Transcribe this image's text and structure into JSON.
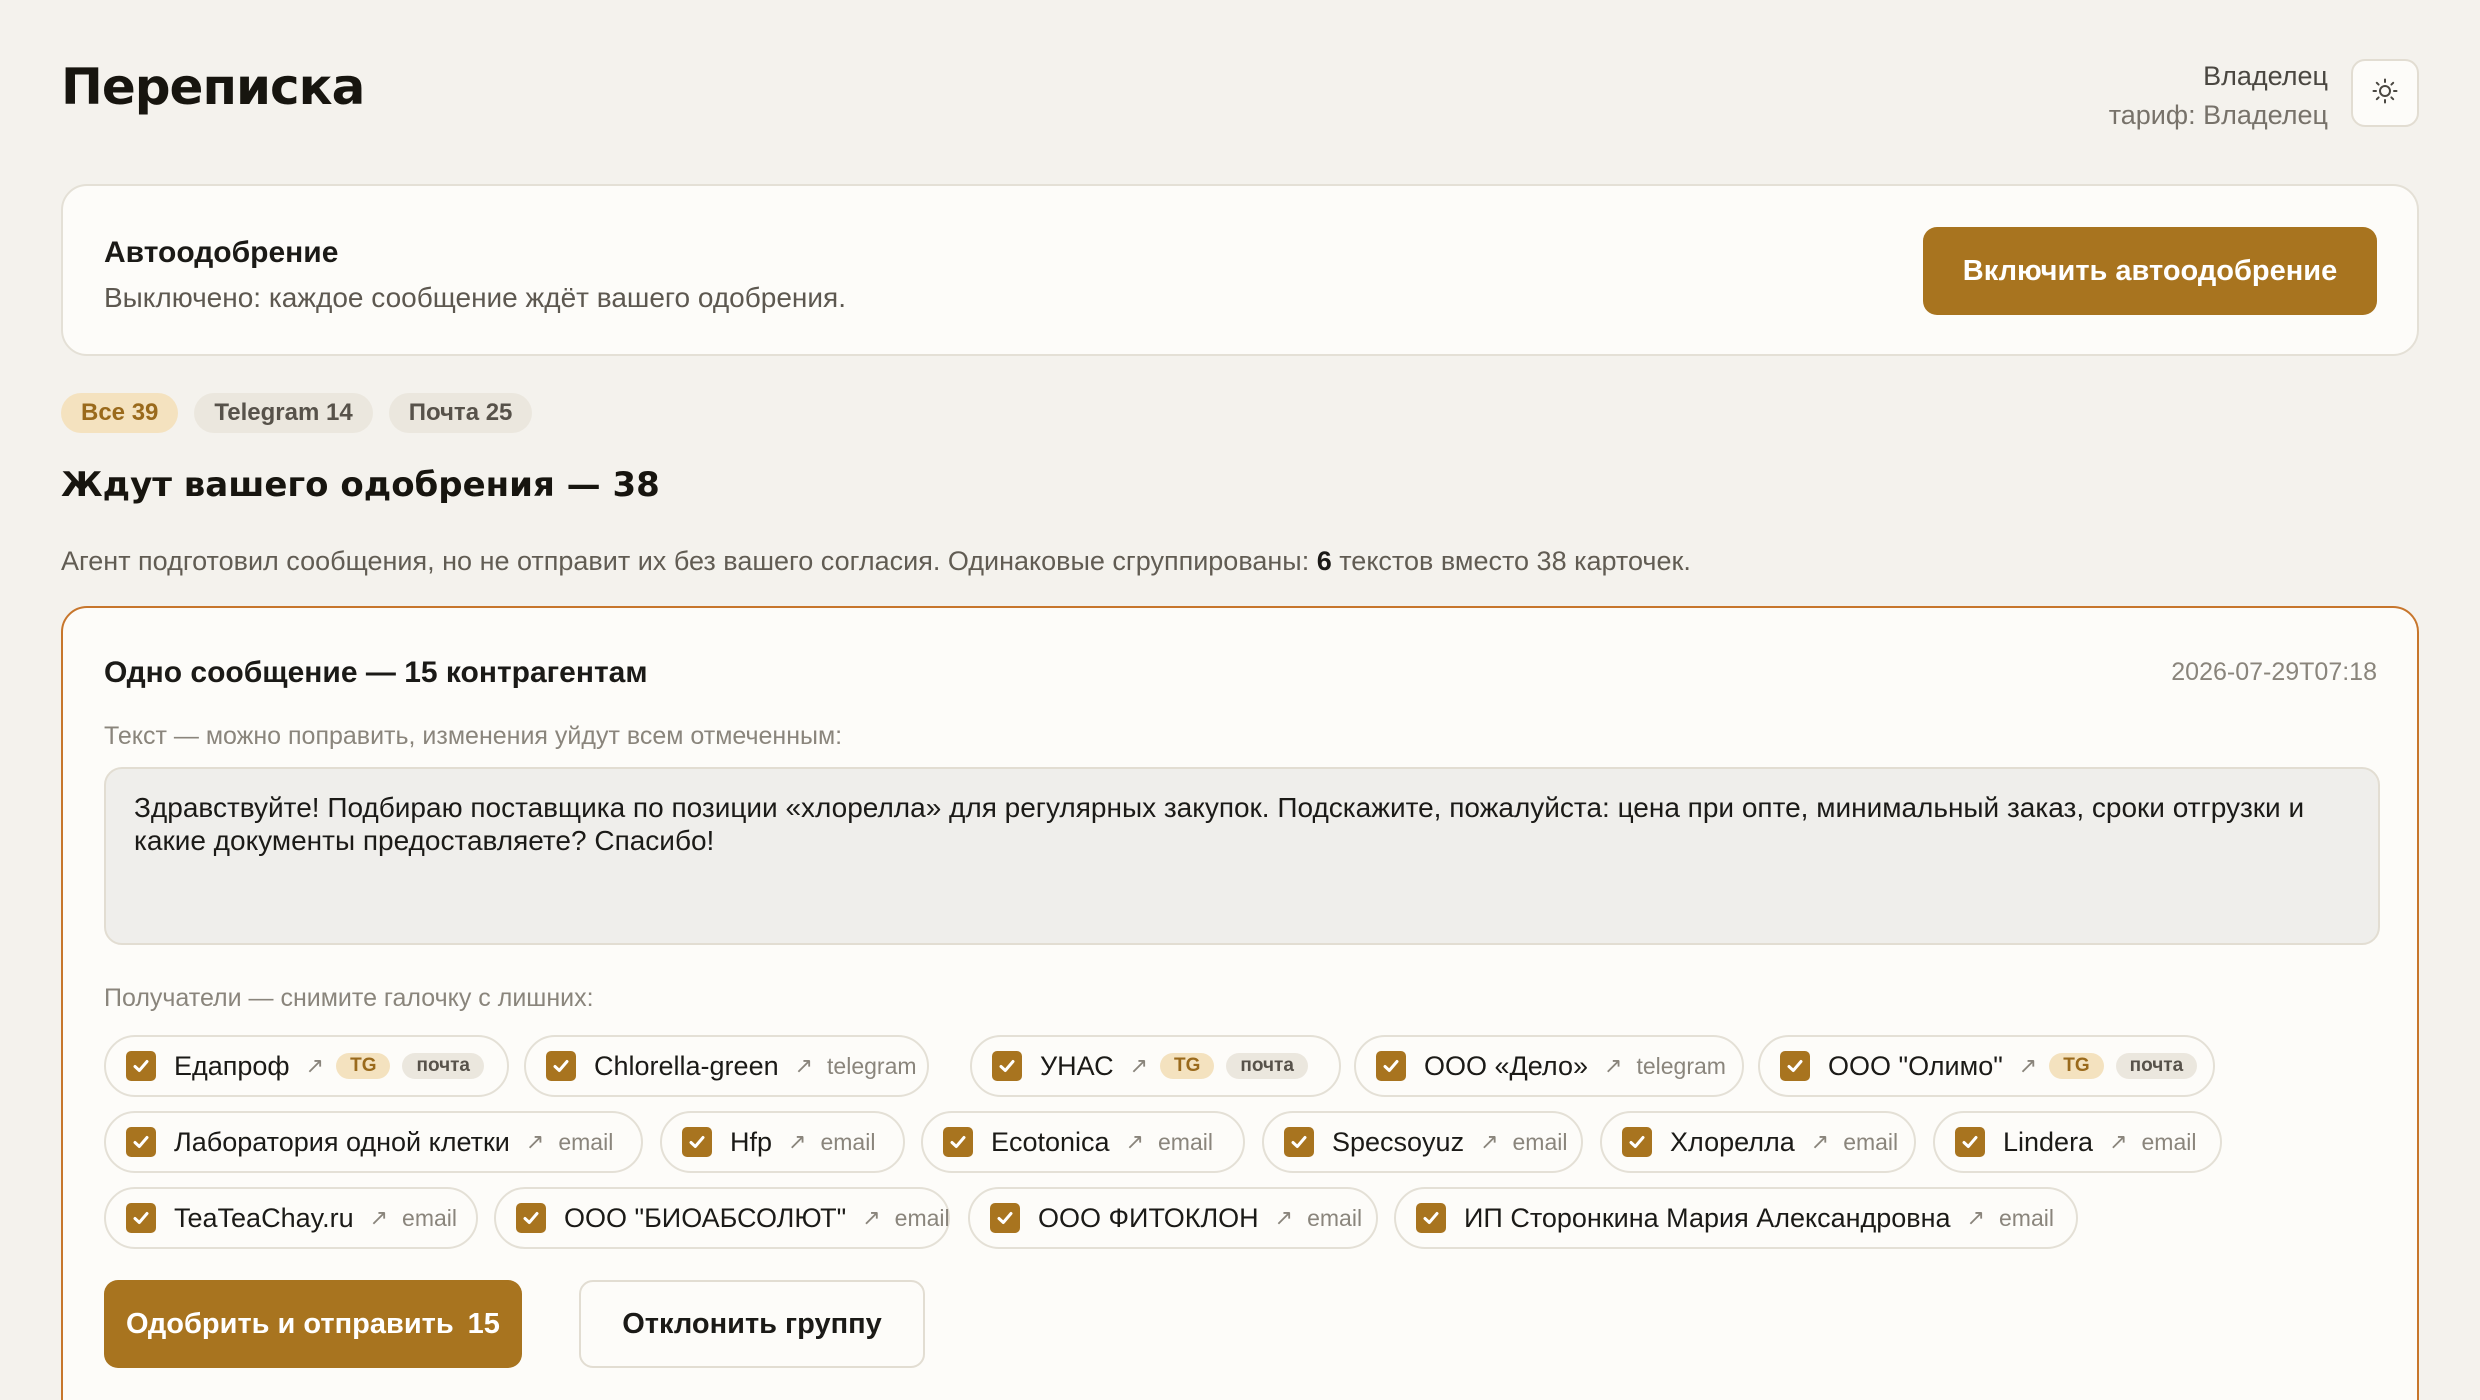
{
  "header": {
    "title": "Переписка",
    "user_name": "Владелец",
    "user_plan": "тариф: Владелец",
    "theme_icon": "sun-icon"
  },
  "auto_approve": {
    "title": "Автоодобрение",
    "description": "Выключено: каждое сообщение ждёт вашего одобрения.",
    "button_label": "Включить автоодобрение"
  },
  "filters": [
    {
      "label": "Все 39",
      "active": true
    },
    {
      "label": "Telegram 14",
      "active": false
    },
    {
      "label": "Почта 25",
      "active": false
    }
  ],
  "section": {
    "title": "Ждут вашего одобрения — 38",
    "subtitle_before": "Агент подготовил сообщения, но не отправит их без вашего согласия. Одинаковые сгруппированы: ",
    "subtitle_count": "6",
    "subtitle_after": " текстов вместо 38 карточек."
  },
  "group": {
    "title": "Одно сообщение — 15 контрагентам",
    "date": "2026-07-29T07:18",
    "text_label": "Текст — можно поправить, изменения уйдут всем отмеченным:",
    "message": "Здравствуйте! Подбираю поставщика по позиции «хлорелла» для регулярных закупок. Подскажите, пожалуйста: цена при опте, минимальный заказ, сроки отгрузки и какие документы предоставляете? Спасибо!",
    "recipients_label": "Получатели — снимите галочку с лишних:",
    "link_glyph": "↗",
    "tag_tg": "TG",
    "tag_mail": "почта",
    "recipients": [
      {
        "name": "Едапроф",
        "checked": true,
        "channel": "",
        "tg": true,
        "mail": true
      },
      {
        "name": "Chlorella-green",
        "checked": true,
        "channel": "telegram",
        "tg": false,
        "mail": false
      },
      {
        "name": "УНАС",
        "checked": true,
        "channel": "",
        "tg": true,
        "mail": true
      },
      {
        "name": "ООО «Дело»",
        "checked": true,
        "channel": "telegram",
        "tg": false,
        "mail": false
      },
      {
        "name": "ООО \"Олимо\"",
        "checked": true,
        "channel": "",
        "tg": true,
        "mail": true
      },
      {
        "name": "Лаборатория одной клетки",
        "checked": true,
        "channel": "email",
        "tg": false,
        "mail": false
      },
      {
        "name": "Hfp",
        "checked": true,
        "channel": "email",
        "tg": false,
        "mail": false
      },
      {
        "name": "Ecotonica",
        "checked": true,
        "channel": "email",
        "tg": false,
        "mail": false
      },
      {
        "name": "Specsoyuz",
        "checked": true,
        "channel": "email",
        "tg": false,
        "mail": false
      },
      {
        "name": "Хлорелла",
        "checked": true,
        "channel": "email",
        "tg": false,
        "mail": false
      },
      {
        "name": "Lindera",
        "checked": true,
        "channel": "email",
        "tg": false,
        "mail": false
      },
      {
        "name": "TeaTeaChay.ru",
        "checked": true,
        "channel": "email",
        "tg": false,
        "mail": false
      },
      {
        "name": "ООО \"БИОАБСОЛЮТ\"",
        "checked": true,
        "channel": "email",
        "tg": false,
        "mail": false
      },
      {
        "name": "ООО ФИТОКЛОН",
        "checked": true,
        "channel": "email",
        "tg": false,
        "mail": false
      },
      {
        "name": "ИП Сторонкина Мария Александровна",
        "checked": true,
        "channel": "email",
        "tg": false,
        "mail": false
      }
    ],
    "approve_label": "Одобрить и отправить",
    "approve_count": "15",
    "reject_label": "Отклонить группу"
  },
  "colors": {
    "accent": "#a8741f",
    "border_active": "#c7762c",
    "background": "#f4f2ed"
  }
}
